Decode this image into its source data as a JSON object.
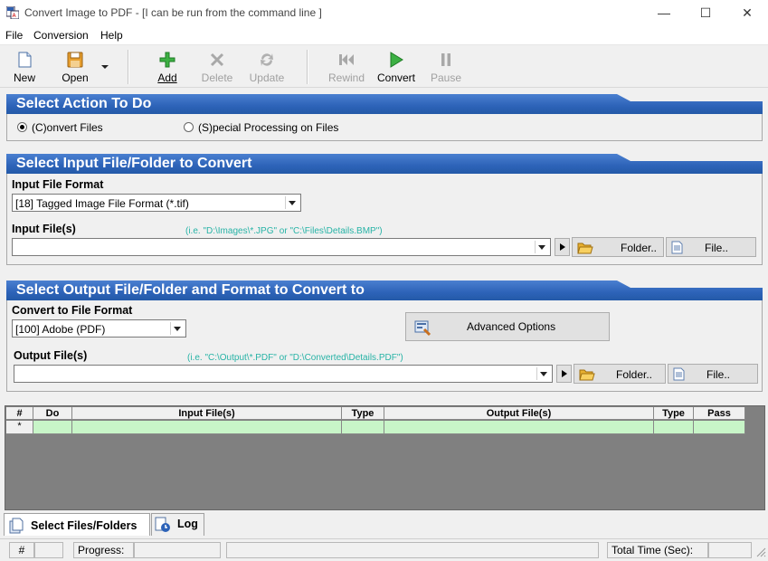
{
  "window": {
    "title": "Convert Image to PDF - [I can be run from the command line ]",
    "minimize": "—",
    "maximize": "☐",
    "close": "✕"
  },
  "menu": [
    "File",
    "Conversion",
    "Help"
  ],
  "toolbar": {
    "new": "New",
    "open": "Open",
    "add": "Add",
    "delete": "Delete",
    "update": "Update",
    "rewind": "Rewind",
    "convert": "Convert",
    "pause": "Pause"
  },
  "action_section": {
    "header": "Select Action To Do",
    "option_convert": "(C)onvert Files",
    "option_special": "(S)pecial Processing on Files",
    "selected": "convert"
  },
  "input_section": {
    "header": "Select Input File/Folder to Convert",
    "format_label": "Input File Format",
    "format_value": "[18] Tagged Image File Format (*.tif)",
    "files_label": "Input File(s)",
    "files_hint": "(i.e. \"D:\\Images\\*.JPG\" or \"C:\\Files\\Details.BMP\")",
    "files_value": "",
    "folder_button": "Folder..",
    "file_button": "File.."
  },
  "output_section": {
    "header": "Select Output File/Folder and Format to Convert to",
    "format_label": "Convert to File Format",
    "format_value": "[100] Adobe (PDF)",
    "advanced_button": "Advanced Options",
    "files_label": "Output File(s)",
    "files_hint": "(i.e. \"C:\\Output\\*.PDF\" or \"D:\\Converted\\Details.PDF\")",
    "files_value": "",
    "folder_button": "Folder..",
    "file_button": "File.."
  },
  "grid": {
    "columns": [
      "#",
      "Do",
      "Input File(s)",
      "Type",
      "Output File(s)",
      "Type",
      "Pass"
    ],
    "new_row_marker": "*"
  },
  "tabs": {
    "files": "Select Files/Folders",
    "log": "Log"
  },
  "status": {
    "hash": "#",
    "progress": "Progress:",
    "total_time": "Total Time (Sec):"
  },
  "colors": {
    "header_blue": "#2d63b8",
    "hint_teal": "#27b3a6",
    "grid_row_green": "#c8f5c8"
  }
}
